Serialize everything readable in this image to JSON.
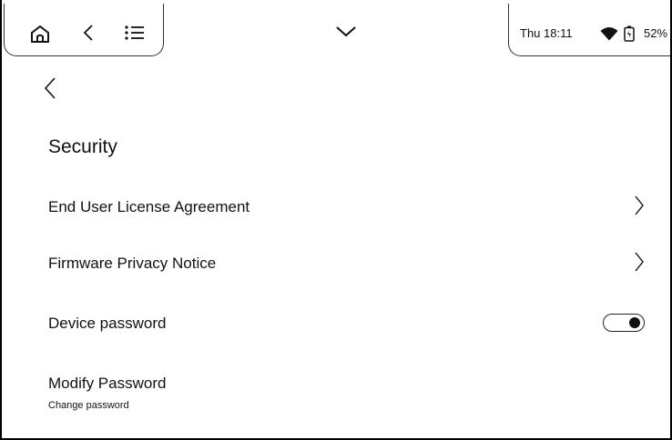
{
  "status_bar": {
    "time": "Thu 18:11",
    "battery_percent": "52%",
    "icons": [
      "home-icon",
      "back-icon",
      "menu-list-icon",
      "pull-down-icon",
      "wifi-icon",
      "battery-icon"
    ]
  },
  "page": {
    "title": "Security"
  },
  "settings": {
    "eula_label": "End User License Agreement",
    "privacy_label": "Firmware Privacy Notice",
    "device_password_label": "Device password",
    "device_password_enabled": true,
    "modify_password_label": "Modify Password",
    "modify_password_sub": "Change password"
  }
}
